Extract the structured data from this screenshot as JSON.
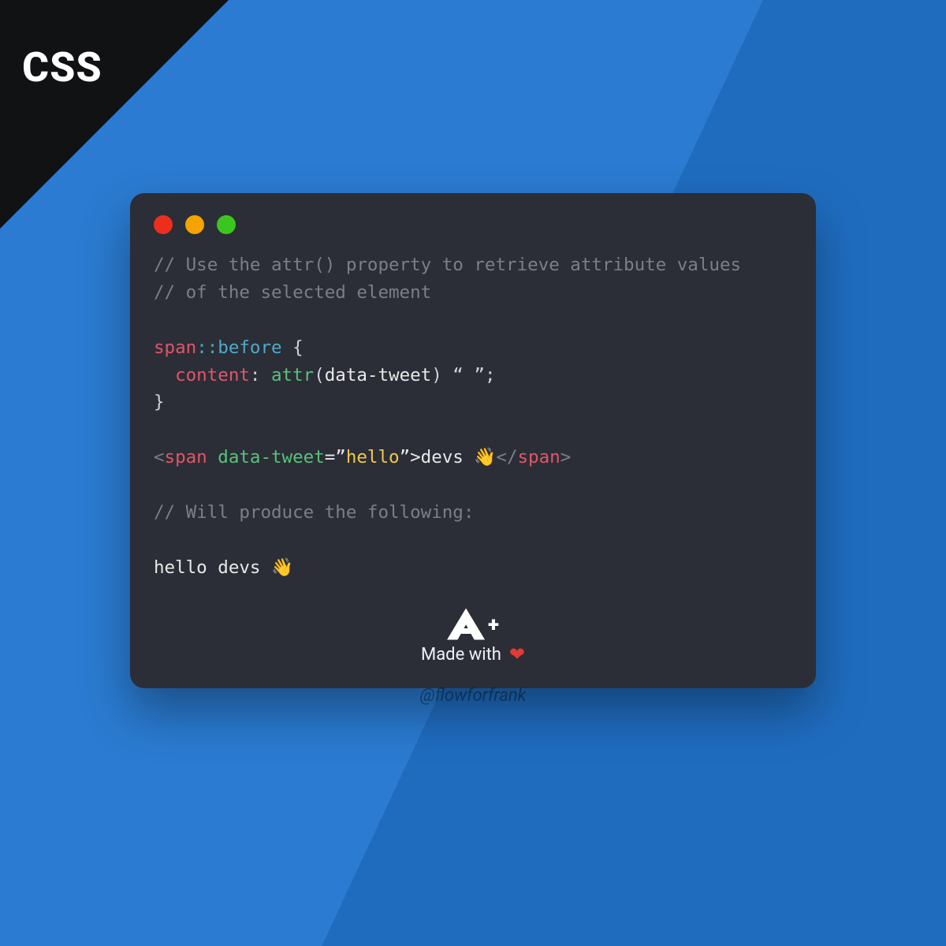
{
  "corner": {
    "label": "CSS"
  },
  "window": {
    "traffic_light_names": {
      "red": "close-icon",
      "yellow": "minimize-icon",
      "green": "zoom-icon"
    },
    "code": {
      "comment1": "// Use the attr() property to retrieve attribute values",
      "comment2": "// of the selected element",
      "css": {
        "selector": "span",
        "pseudo_colons": "::",
        "pseudo": "before",
        "open_brace": " {",
        "indent": "  ",
        "prop": "content",
        "colon": ": ",
        "func": "attr",
        "paren_open": "(",
        "arg": "data-tweet",
        "paren_close": ")",
        "tail": " “ ”;",
        "close_brace": "}"
      },
      "html": {
        "lt": "<",
        "tag": "span",
        "space": " ",
        "attr": "data-tweet",
        "eq_q1": "=”",
        "val": "hello",
        "q2_gt": "”>",
        "text": "devs 👋",
        "lt_slash": "</",
        "close_tag": "span",
        "gt": ">"
      },
      "comment3": "// Will produce the following:",
      "output": "hello devs 👋"
    },
    "footer": {
      "made_with": "Made with",
      "heart": "❤"
    }
  },
  "handle": "@flowforfrank"
}
